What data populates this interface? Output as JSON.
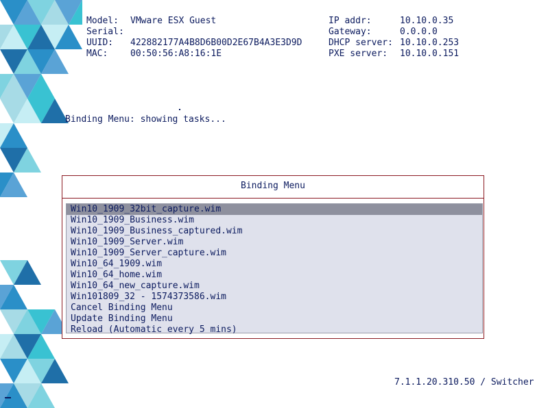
{
  "system_info": {
    "left": [
      {
        "label": "Model:",
        "value": "VMware ESX Guest"
      },
      {
        "label": "Serial:",
        "value": ""
      },
      {
        "label": "UUID:",
        "value": "422882177A4B8D6B00D2E67B4A3E3D9D"
      },
      {
        "label": "MAC:",
        "value": "00:50:56:A8:16:1E"
      }
    ],
    "right": [
      {
        "label": "IP addr:",
        "value": "10.10.0.35"
      },
      {
        "label": "Gateway:",
        "value": "0.0.0.0"
      },
      {
        "label": "DHCP server:",
        "value": "10.10.0.253"
      },
      {
        "label": "PXE server:",
        "value": "10.10.0.151"
      }
    ]
  },
  "status_text": "Binding Menu: showing tasks...",
  "menu": {
    "title": "Binding Menu",
    "selected_index": 0,
    "items": [
      "Win10_1909_32bit_capture.wim",
      "Win10_1909_Business.wim",
      "Win10_1909_Business_captured.wim",
      "Win10_1909_Server.wim",
      "Win10_1909_Server_capture.wim",
      "Win10_64_1909.wim",
      "Win10_64_home.wim",
      "Win10_64_new_capture.wim",
      "Win101809_32 - 1574373586.wim",
      "Cancel Binding Menu",
      "Update Binding Menu",
      "Reload (Automatic every 5 mins)"
    ]
  },
  "version": "7.1.1.20.310.50 / Switcher",
  "colors": {
    "text": "#0b1a5e",
    "frame": "#8b1a22",
    "list_bg": "#dfe1ec",
    "selection": "#8e909e",
    "decor_primary": "#2a8fc8",
    "decor_teal": "#39c2d2"
  }
}
